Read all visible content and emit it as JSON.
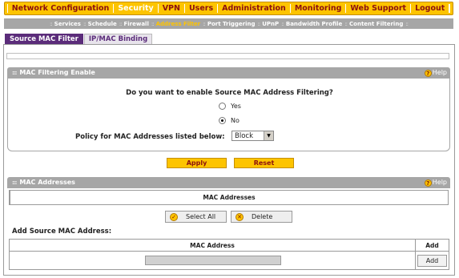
{
  "top_nav": [
    "Network Configuration",
    "Security",
    "VPN",
    "Users",
    "Administration",
    "Monitoring",
    "Web Support",
    "Logout"
  ],
  "top_nav_active": "Security",
  "sub_nav": [
    "Services",
    "Schedule",
    "Firewall",
    "Address Filter",
    "Port Triggering",
    "UPnP",
    "Bandwidth Profile",
    "Content Filtering"
  ],
  "sub_nav_active": "Address Filter",
  "tabs": [
    "Source MAC Filter",
    "IP/MAC Binding"
  ],
  "filtering_section": {
    "title": "MAC Filtering Enable",
    "help": "Help",
    "question": "Do you want to enable Source MAC Address Filtering?",
    "yes_label": "Yes",
    "no_label": "No",
    "selected": "No",
    "policy_label": "Policy for MAC Addresses listed below:",
    "policy_value": "Block"
  },
  "apply_label": "Apply",
  "reset_label": "Reset",
  "addresses_section": {
    "title": "MAC Addresses",
    "help": "Help",
    "column": "MAC Addresses",
    "select_all_label": "Select All",
    "delete_label": "Delete"
  },
  "add_section": {
    "title": "Add Source MAC Address:",
    "col_address": "MAC Address",
    "col_add": "Add",
    "input_value": "",
    "add_button": "Add"
  },
  "colors": {
    "accent": "#fdc400",
    "nav_text": "#8b1010",
    "tab_active": "#5b2c7a",
    "header_grey": "#a6a6a6"
  }
}
